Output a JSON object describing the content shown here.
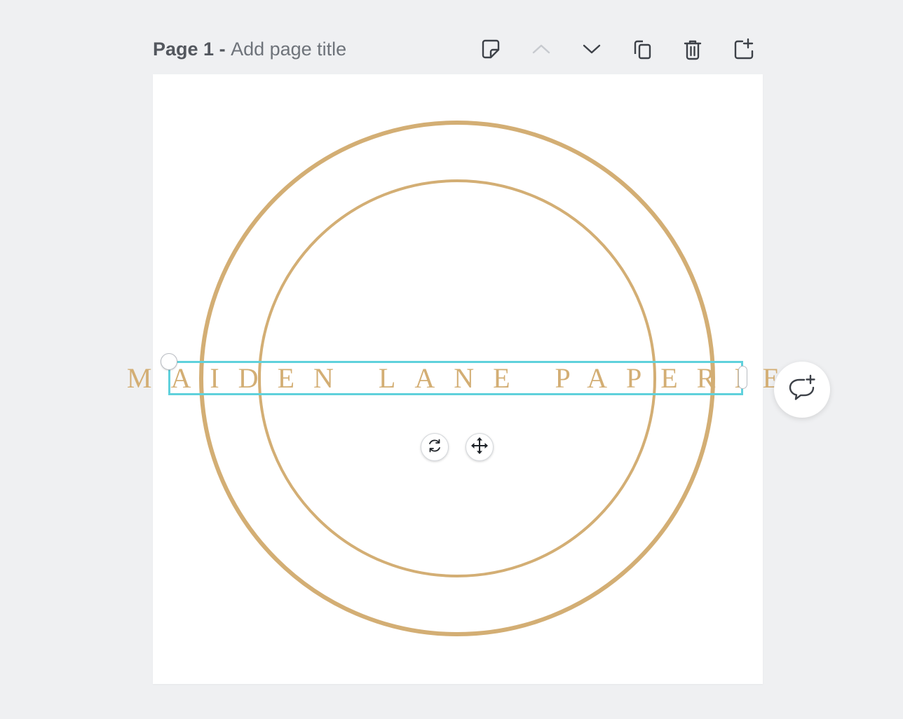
{
  "header": {
    "page_label": "Page 1",
    "separator": " - ",
    "title_placeholder": "Add page title"
  },
  "toolbar": {
    "icons": [
      "notes-icon",
      "move-up-icon",
      "move-down-icon",
      "duplicate-page-icon",
      "delete-page-icon",
      "add-page-icon"
    ]
  },
  "canvas": {
    "text": "MAIDEN LANE PAPERIE",
    "text_color": "#d3ae74",
    "circle_color": "#d3ae74",
    "selection_color": "#5fd1dc"
  },
  "controls": {
    "rotate_icon": "rotate-icon",
    "move_icon": "move-icon",
    "comment_icon": "add-comment-icon"
  }
}
